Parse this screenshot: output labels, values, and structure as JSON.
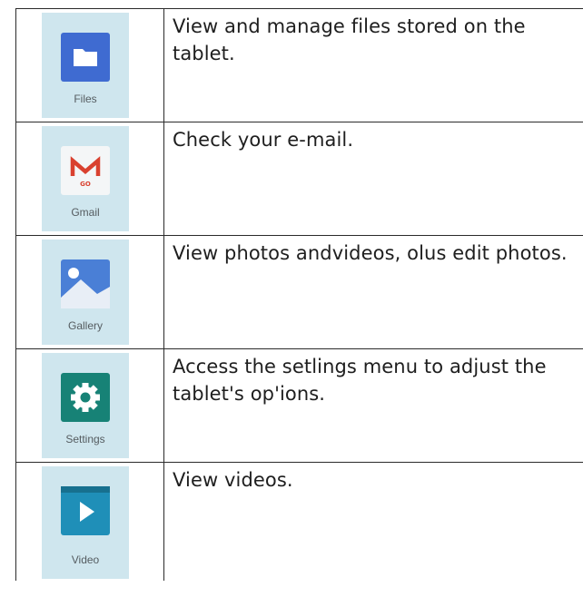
{
  "apps": [
    {
      "icon": "files-folder-icon",
      "label": "Files",
      "description": "View and manage files stored on the tablet.",
      "color": "#3f6bd1"
    },
    {
      "icon": "gmail-icon",
      "label": "Gmail",
      "description": "Check your e-mail.",
      "color": "#d9412f"
    },
    {
      "icon": "gallery-photo-icon",
      "label": "Gallery",
      "description": "View photos andvideos, olus edit photos.",
      "color": "#4a7fd6"
    },
    {
      "icon": "settings-gear-icon",
      "label": "Settings",
      "description": "Access the setlings menu to adjust the tablet's op'ions.",
      "color": "#178276"
    },
    {
      "icon": "video-play-icon",
      "label": "Video",
      "description": "View  videos.",
      "color": "#1f8fb8"
    }
  ]
}
